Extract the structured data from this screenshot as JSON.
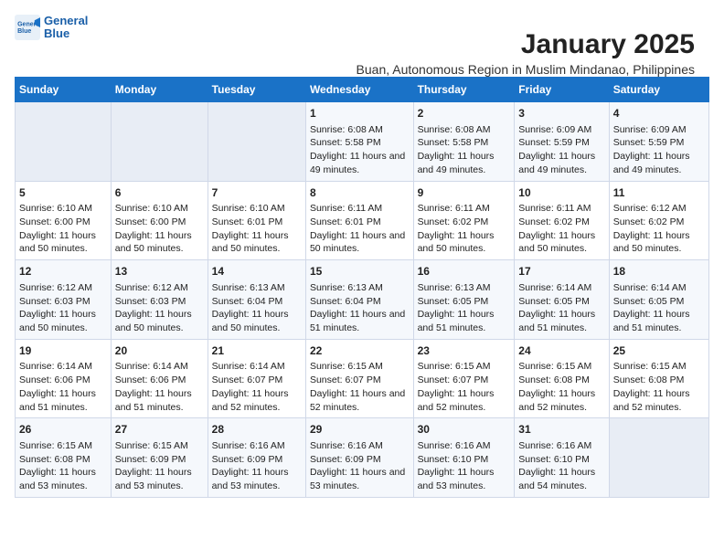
{
  "logo": {
    "line1": "General",
    "line2": "Blue"
  },
  "title": "January 2025",
  "subtitle": "Buan, Autonomous Region in Muslim Mindanao, Philippines",
  "headers": [
    "Sunday",
    "Monday",
    "Tuesday",
    "Wednesday",
    "Thursday",
    "Friday",
    "Saturday"
  ],
  "weeks": [
    [
      {
        "day": "",
        "content": ""
      },
      {
        "day": "",
        "content": ""
      },
      {
        "day": "",
        "content": ""
      },
      {
        "day": "1",
        "content": "Sunrise: 6:08 AM\nSunset: 5:58 PM\nDaylight: 11 hours and 49 minutes."
      },
      {
        "day": "2",
        "content": "Sunrise: 6:08 AM\nSunset: 5:58 PM\nDaylight: 11 hours and 49 minutes."
      },
      {
        "day": "3",
        "content": "Sunrise: 6:09 AM\nSunset: 5:59 PM\nDaylight: 11 hours and 49 minutes."
      },
      {
        "day": "4",
        "content": "Sunrise: 6:09 AM\nSunset: 5:59 PM\nDaylight: 11 hours and 49 minutes."
      }
    ],
    [
      {
        "day": "5",
        "content": "Sunrise: 6:10 AM\nSunset: 6:00 PM\nDaylight: 11 hours and 50 minutes."
      },
      {
        "day": "6",
        "content": "Sunrise: 6:10 AM\nSunset: 6:00 PM\nDaylight: 11 hours and 50 minutes."
      },
      {
        "day": "7",
        "content": "Sunrise: 6:10 AM\nSunset: 6:01 PM\nDaylight: 11 hours and 50 minutes."
      },
      {
        "day": "8",
        "content": "Sunrise: 6:11 AM\nSunset: 6:01 PM\nDaylight: 11 hours and 50 minutes."
      },
      {
        "day": "9",
        "content": "Sunrise: 6:11 AM\nSunset: 6:02 PM\nDaylight: 11 hours and 50 minutes."
      },
      {
        "day": "10",
        "content": "Sunrise: 6:11 AM\nSunset: 6:02 PM\nDaylight: 11 hours and 50 minutes."
      },
      {
        "day": "11",
        "content": "Sunrise: 6:12 AM\nSunset: 6:02 PM\nDaylight: 11 hours and 50 minutes."
      }
    ],
    [
      {
        "day": "12",
        "content": "Sunrise: 6:12 AM\nSunset: 6:03 PM\nDaylight: 11 hours and 50 minutes."
      },
      {
        "day": "13",
        "content": "Sunrise: 6:12 AM\nSunset: 6:03 PM\nDaylight: 11 hours and 50 minutes."
      },
      {
        "day": "14",
        "content": "Sunrise: 6:13 AM\nSunset: 6:04 PM\nDaylight: 11 hours and 50 minutes."
      },
      {
        "day": "15",
        "content": "Sunrise: 6:13 AM\nSunset: 6:04 PM\nDaylight: 11 hours and 51 minutes."
      },
      {
        "day": "16",
        "content": "Sunrise: 6:13 AM\nSunset: 6:05 PM\nDaylight: 11 hours and 51 minutes."
      },
      {
        "day": "17",
        "content": "Sunrise: 6:14 AM\nSunset: 6:05 PM\nDaylight: 11 hours and 51 minutes."
      },
      {
        "day": "18",
        "content": "Sunrise: 6:14 AM\nSunset: 6:05 PM\nDaylight: 11 hours and 51 minutes."
      }
    ],
    [
      {
        "day": "19",
        "content": "Sunrise: 6:14 AM\nSunset: 6:06 PM\nDaylight: 11 hours and 51 minutes."
      },
      {
        "day": "20",
        "content": "Sunrise: 6:14 AM\nSunset: 6:06 PM\nDaylight: 11 hours and 51 minutes."
      },
      {
        "day": "21",
        "content": "Sunrise: 6:14 AM\nSunset: 6:07 PM\nDaylight: 11 hours and 52 minutes."
      },
      {
        "day": "22",
        "content": "Sunrise: 6:15 AM\nSunset: 6:07 PM\nDaylight: 11 hours and 52 minutes."
      },
      {
        "day": "23",
        "content": "Sunrise: 6:15 AM\nSunset: 6:07 PM\nDaylight: 11 hours and 52 minutes."
      },
      {
        "day": "24",
        "content": "Sunrise: 6:15 AM\nSunset: 6:08 PM\nDaylight: 11 hours and 52 minutes."
      },
      {
        "day": "25",
        "content": "Sunrise: 6:15 AM\nSunset: 6:08 PM\nDaylight: 11 hours and 52 minutes."
      }
    ],
    [
      {
        "day": "26",
        "content": "Sunrise: 6:15 AM\nSunset: 6:08 PM\nDaylight: 11 hours and 53 minutes."
      },
      {
        "day": "27",
        "content": "Sunrise: 6:15 AM\nSunset: 6:09 PM\nDaylight: 11 hours and 53 minutes."
      },
      {
        "day": "28",
        "content": "Sunrise: 6:16 AM\nSunset: 6:09 PM\nDaylight: 11 hours and 53 minutes."
      },
      {
        "day": "29",
        "content": "Sunrise: 6:16 AM\nSunset: 6:09 PM\nDaylight: 11 hours and 53 minutes."
      },
      {
        "day": "30",
        "content": "Sunrise: 6:16 AM\nSunset: 6:10 PM\nDaylight: 11 hours and 53 minutes."
      },
      {
        "day": "31",
        "content": "Sunrise: 6:16 AM\nSunset: 6:10 PM\nDaylight: 11 hours and 54 minutes."
      },
      {
        "day": "",
        "content": ""
      }
    ]
  ]
}
